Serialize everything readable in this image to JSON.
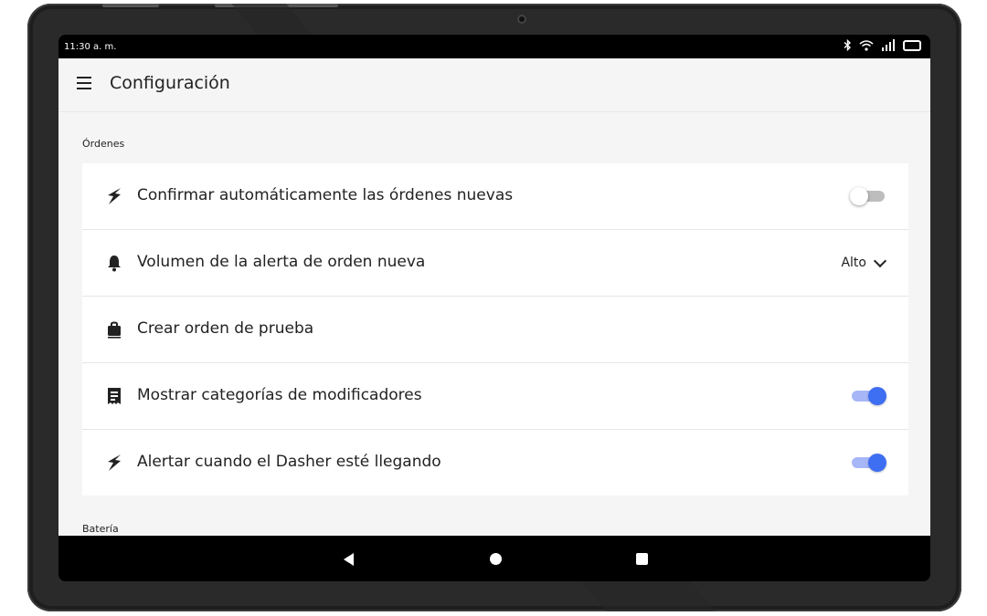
{
  "status_bar": {
    "time": "11:30 a. m.",
    "icons": [
      "bluetooth-icon",
      "wifi-icon",
      "signal-5g-icon",
      "battery-icon"
    ]
  },
  "app_bar": {
    "menu_icon": "menu-icon",
    "title": "Configuración"
  },
  "sections": [
    {
      "label": "Órdenes",
      "items": [
        {
          "icon": "lightning-icon",
          "label": "Confirmar automáticamente las órdenes nuevas",
          "control": "toggle",
          "enabled": false
        },
        {
          "icon": "bell-icon",
          "label": "Volumen de la alerta de orden nueva",
          "control": "dropdown",
          "value": "Alto"
        },
        {
          "icon": "bag-icon",
          "label": "Crear orden de prueba",
          "control": "none"
        },
        {
          "icon": "receipt-icon",
          "label": "Mostrar categorías de modificadores",
          "control": "toggle",
          "enabled": true
        },
        {
          "icon": "lightning-icon",
          "label": "Alertar cuando el Dasher esté llegando",
          "control": "toggle",
          "enabled": true
        }
      ]
    },
    {
      "label": "Batería",
      "items": []
    }
  ],
  "nav_bar": {
    "buttons": [
      "back-icon",
      "home-icon",
      "recents-icon"
    ]
  },
  "colors": {
    "accent": "#3e6ef2",
    "toggle_track_on": "#a7b6f7",
    "background": "#f5f5f5",
    "bezel": "#2a2a2a"
  }
}
